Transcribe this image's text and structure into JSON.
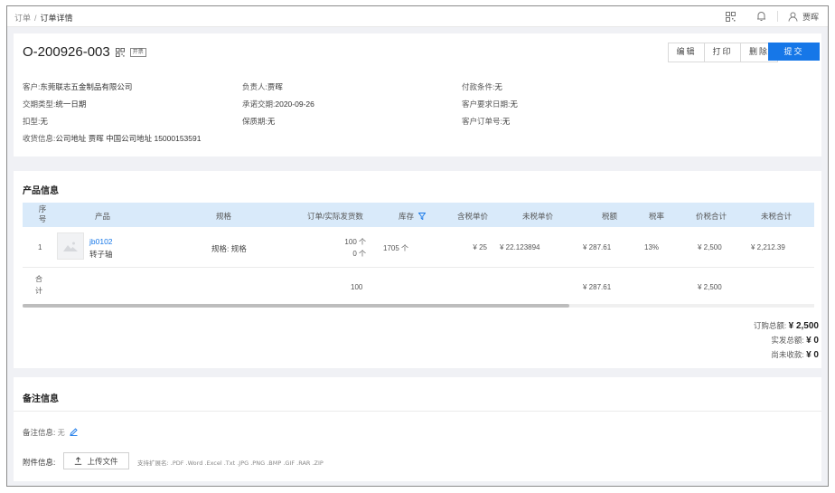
{
  "breadcrumb": {
    "root": "订单",
    "separator": "/",
    "current": "订单详情"
  },
  "topbar": {
    "user_name": "贾晖"
  },
  "header": {
    "order_no": "O-200926-003",
    "open_tag": "开票",
    "buttons": {
      "edit": "编辑",
      "print": "打印",
      "delete": "删除",
      "submit": "提交"
    }
  },
  "info": {
    "customer": {
      "label": "客户:",
      "value": "东莞联志五金制品有限公司"
    },
    "delivery_type": {
      "label": "交期类型:",
      "value": "统一日期"
    },
    "buckle": {
      "label": "扣型:",
      "value": "无"
    },
    "shipping": {
      "label": "收货信息:",
      "value": "公司地址 贾晖 中国公司地址 15000153591"
    },
    "owner": {
      "label": "负责人:",
      "value": "贾晖"
    },
    "promise_date": {
      "label": "承诺交期:",
      "value": "2020-09-26"
    },
    "warranty": {
      "label": "保质期:",
      "value": "无"
    },
    "payment": {
      "label": "付款条件:",
      "value": "无"
    },
    "customer_req_date": {
      "label": "客户要求日期:",
      "value": "无"
    },
    "customer_order_no": {
      "label": "客户订单号:",
      "value": "无"
    }
  },
  "products": {
    "title": "产品信息",
    "columns": {
      "seq": "序号",
      "product": "产品",
      "spec": "规格",
      "qty": "订单/实际发货数",
      "stock": "库存",
      "price_tax": "含税单价",
      "price_notax": "未税单价",
      "tax_amount": "税额",
      "tax_rate": "税率",
      "total": "价税合计",
      "total_notax": "未税合计"
    },
    "row": {
      "seq": "1",
      "code": "jb0102",
      "name": "转子轴",
      "spec": "规格: 规格",
      "order_qty": "100 个",
      "shipped_qty": "0 个",
      "stock": "1705 个",
      "price_tax": "¥ 25",
      "price_notax": "¥ 22.123894",
      "tax_amount": "¥ 287.61",
      "tax_rate": "13%",
      "total": "¥ 2,500",
      "total_notax": "¥ 2,212.39"
    },
    "sum_row": {
      "label": "合计",
      "qty": "100",
      "tax_amount": "¥ 287.61",
      "total": "¥ 2,500"
    },
    "totals": {
      "purchase_label": "订购总额:",
      "purchase_value": "¥ 2,500",
      "shipped_label": "实发总额:",
      "shipped_value": "¥ 0",
      "unreceived_label": "尚未收款:",
      "unreceived_value": "¥ 0"
    }
  },
  "remarks": {
    "title": "备注信息",
    "remark_label": "备注信息:",
    "remark_value": "无",
    "attach_label": "附件信息:",
    "upload_label": "上传文件",
    "hint": "支持扩展名: .PDF .Word .Excel .Txt .JPG .PNG .BMP .GIF .RAR .ZIP"
  },
  "colors": {
    "accent": "#1677e8",
    "table_header_bg": "#d9eafa",
    "page_bg": "#f0f1f5"
  }
}
